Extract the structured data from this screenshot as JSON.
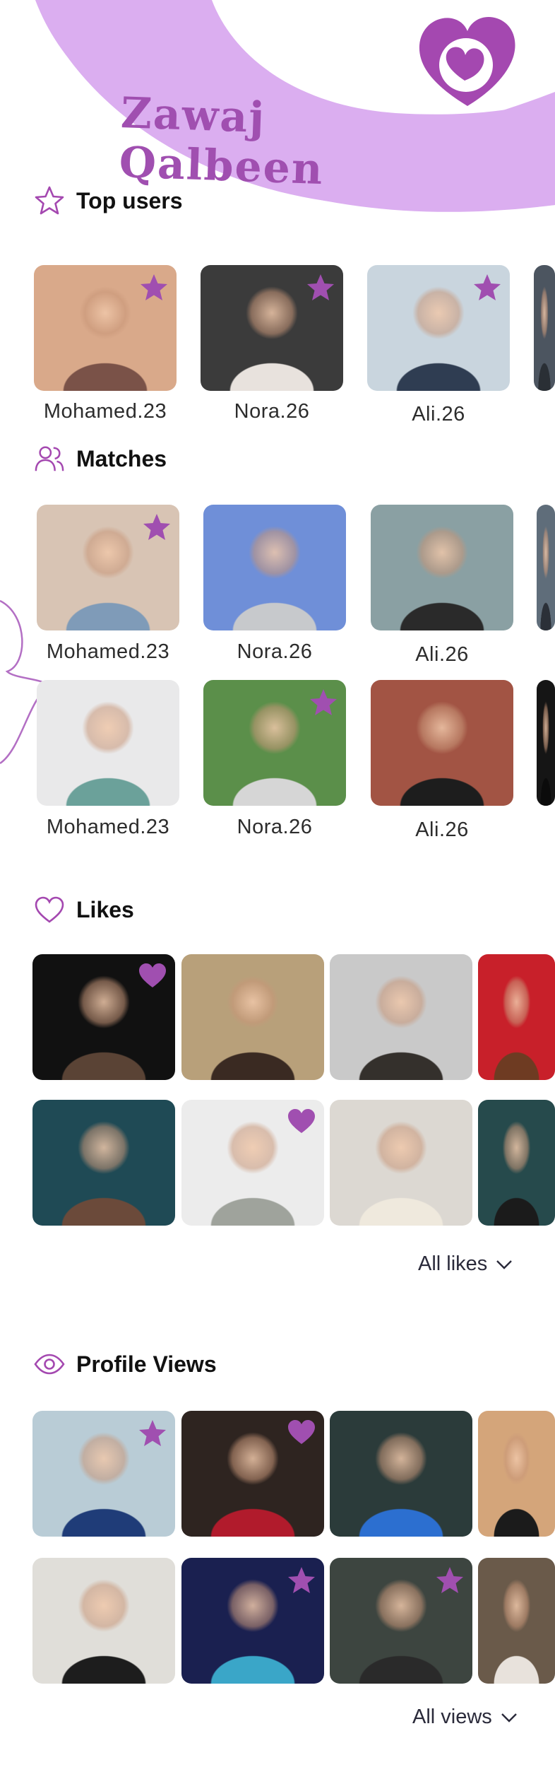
{
  "app": {
    "title": "Zawaj Qalbeen",
    "accent": "#a04fb0",
    "banner_color": "#dbaef0"
  },
  "sections": {
    "top_users": {
      "title": "Top users",
      "icon": "star-outline-icon",
      "users": [
        {
          "name": "Mohamed.23",
          "badge": "star-icon",
          "bg": [
            "#d9a98a",
            "#7a5248"
          ]
        },
        {
          "name": "Nora.26",
          "badge": "star-icon",
          "bg": [
            "#3b3b3b",
            "#e8e2dd"
          ]
        },
        {
          "name": "Ali.26",
          "badge": "star-icon",
          "bg": [
            "#c9d5de",
            "#2f3d52"
          ]
        },
        {
          "name": "",
          "badge": "",
          "bg": [
            "#4c5560",
            "#2a2f35"
          ]
        }
      ]
    },
    "matches": {
      "title": "Matches",
      "icon": "users-icon",
      "rows": [
        [
          {
            "name": "Mohamed.23",
            "badge": "star-icon",
            "bg": [
              "#d8c4b4",
              "#7f9bb8"
            ]
          },
          {
            "name": "Nora.26",
            "badge": "",
            "bg": [
              "#6f8fd8",
              "#c7c9cc"
            ]
          },
          {
            "name": "Ali.26",
            "badge": "",
            "bg": [
              "#8aa0a3",
              "#2a2a2a"
            ]
          },
          {
            "name": "",
            "badge": "",
            "bg": [
              "#5f6d7a",
              "#2b3038"
            ]
          }
        ],
        [
          {
            "name": "Mohamed.23",
            "badge": "",
            "bg": [
              "#e9e9ea",
              "#6ba19a"
            ]
          },
          {
            "name": "Nora.26",
            "badge": "star-icon",
            "bg": [
              "#5b8f4a",
              "#d6d6d6"
            ]
          },
          {
            "name": "Ali.26",
            "badge": "",
            "bg": [
              "#a25444",
              "#1d1d1d"
            ]
          },
          {
            "name": "",
            "badge": "",
            "bg": [
              "#151515",
              "#0b0b0b"
            ]
          }
        ]
      ]
    },
    "likes": {
      "title": "Likes",
      "icon": "heart-outline-icon",
      "rows": [
        [
          {
            "badge": "heart-icon",
            "bg": [
              "#111111",
              "#5a4335"
            ]
          },
          {
            "badge": "",
            "bg": [
              "#b8a07a",
              "#3a2a22"
            ]
          },
          {
            "badge": "",
            "bg": [
              "#c9c9c9",
              "#34302c"
            ]
          },
          {
            "badge": "",
            "bg": [
              "#c8202a",
              "#6e3b22"
            ]
          }
        ],
        [
          {
            "badge": "",
            "bg": [
              "#1f4a55",
              "#6b4a3a"
            ]
          },
          {
            "badge": "heart-icon",
            "bg": [
              "#ececec",
              "#9fa39c"
            ]
          },
          {
            "badge": "",
            "bg": [
              "#dcd8d2",
              "#efe9dd"
            ]
          },
          {
            "badge": "",
            "bg": [
              "#264a4c",
              "#1b1b1b"
            ]
          }
        ]
      ],
      "more_label": "All likes"
    },
    "profile_views": {
      "title": "Profile Views",
      "icon": "eye-icon",
      "rows": [
        [
          {
            "badge": "star-icon",
            "bg": [
              "#b9ccd6",
              "#1f3c78"
            ]
          },
          {
            "badge": "heart-icon",
            "bg": [
              "#2e2420",
              "#b11b2c"
            ]
          },
          {
            "badge": "",
            "bg": [
              "#2b3b3a",
              "#2c6fd0"
            ]
          },
          {
            "badge": "",
            "bg": [
              "#d4a57a",
              "#1b1b1b"
            ]
          }
        ],
        [
          {
            "badge": "",
            "bg": [
              "#e0ded9",
              "#1d1d1d"
            ]
          },
          {
            "badge": "star-icon",
            "bg": [
              "#1a2050",
              "#3aa6c8"
            ]
          },
          {
            "badge": "star-icon",
            "bg": [
              "#3d4540",
              "#2a2a2a"
            ]
          },
          {
            "badge": "",
            "bg": [
              "#6a5a4a",
              "#e8e2dc"
            ]
          }
        ]
      ],
      "more_label": "All views"
    }
  }
}
